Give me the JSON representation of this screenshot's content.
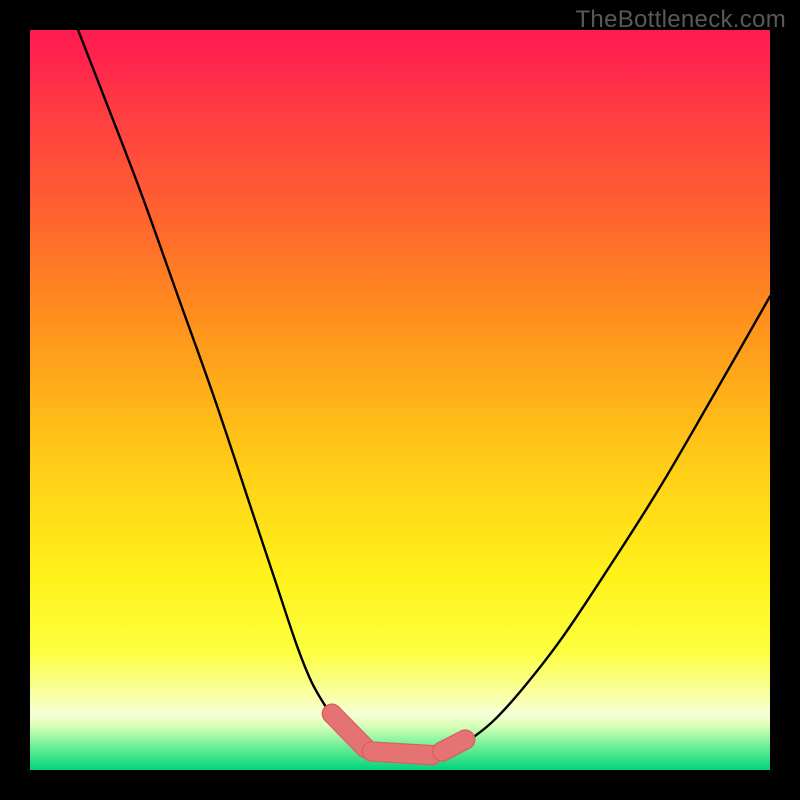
{
  "watermark": "TheBottleneck.com",
  "colors": {
    "curve_stroke": "#000000",
    "sausage_fill": "#e57373",
    "sausage_stroke": "#d85f5f",
    "gradient_top": "#ff1a52",
    "gradient_bottom": "#00d47e"
  },
  "chart_data": {
    "type": "line",
    "title": "",
    "xlabel": "",
    "ylabel": "",
    "xlim": [
      0,
      100
    ],
    "ylim": [
      0,
      100
    ],
    "note": "Bottleneck curve: percentage bottleneck (y, 0 at bottom, 100 at top) vs component balance (x). Two curves form a V shape meeting near the flat bottom. A beaded 'sausage' line overlays the optimal low-bottleneck region.",
    "series": [
      {
        "name": "left-curve",
        "x": [
          6.5,
          10,
          15,
          20,
          25,
          30,
          33,
          36,
          38,
          40,
          41.5,
          43,
          44.5,
          46,
          47.5
        ],
        "y": [
          100,
          91,
          78,
          64,
          50,
          35,
          26,
          17,
          12,
          8.5,
          6.2,
          4.6,
          3.4,
          2.6,
          2.2
        ]
      },
      {
        "name": "right-curve",
        "x": [
          55.5,
          57.5,
          60,
          63,
          67,
          72,
          78,
          85,
          92,
          100
        ],
        "y": [
          2.2,
          3.0,
          4.5,
          7.0,
          11.5,
          18,
          27,
          38,
          50,
          64
        ]
      },
      {
        "name": "valley-floor",
        "x": [
          47.5,
          49,
          51.5,
          54,
          55.5
        ],
        "y": [
          2.2,
          2.05,
          2.0,
          2.05,
          2.2
        ]
      }
    ],
    "sausage_segments": [
      {
        "x0": 40.8,
        "y0": 7.6,
        "x1": 45.3,
        "y1": 3.0
      },
      {
        "x0": 46.2,
        "y0": 2.5,
        "x1": 54.3,
        "y1": 2.0
      },
      {
        "x0": 55.7,
        "y0": 2.5,
        "x1": 58.8,
        "y1": 4.1
      }
    ],
    "sausage_end_radius_px": 9,
    "sausage_stroke_width_px": 18
  }
}
